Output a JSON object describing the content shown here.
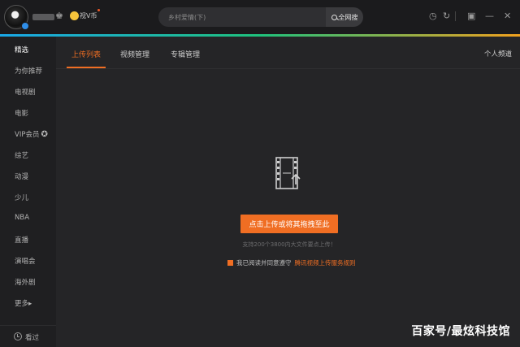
{
  "header": {
    "coin_label": "视V币",
    "search_placeholder": "乡村爱情(下)",
    "search_button_label": "全网搜",
    "icons": [
      "history-icon",
      "refresh-icon",
      "miniplayer-icon",
      "minimize-icon",
      "close-icon"
    ]
  },
  "sidebar": {
    "items": [
      {
        "label": "精选",
        "active": true
      },
      {
        "label": "为你推荐"
      },
      {
        "label": "电视剧"
      },
      {
        "label": "电影"
      },
      {
        "label": "VIP会员"
      },
      {
        "label": "综艺"
      },
      {
        "label": "动漫"
      },
      {
        "label": "少儿"
      },
      {
        "label": "NBA"
      },
      {
        "label": "直播"
      },
      {
        "label": "演唱会"
      },
      {
        "label": "海外剧"
      },
      {
        "label": "更多▸"
      }
    ],
    "history_label": "看过"
  },
  "main": {
    "tabs": [
      {
        "label": "上传列表",
        "active": true
      },
      {
        "label": "视频管理"
      },
      {
        "label": "专辑管理"
      }
    ],
    "personal_channel_label": "个人频道",
    "upload_button_label": "点击上传或将其拖拽至此",
    "hint_text": "支持200个3800内大文件要点上传！",
    "agree_text": "我已阅读并同意遵守",
    "agree_link": "腾讯视频上传服务规则"
  },
  "watermark": "百家号/最炫科技馆",
  "colors": {
    "accent": "#f06e23",
    "background": "#252527",
    "sidebar": "#1f1f21",
    "titlebar": "#1b1b1d"
  }
}
